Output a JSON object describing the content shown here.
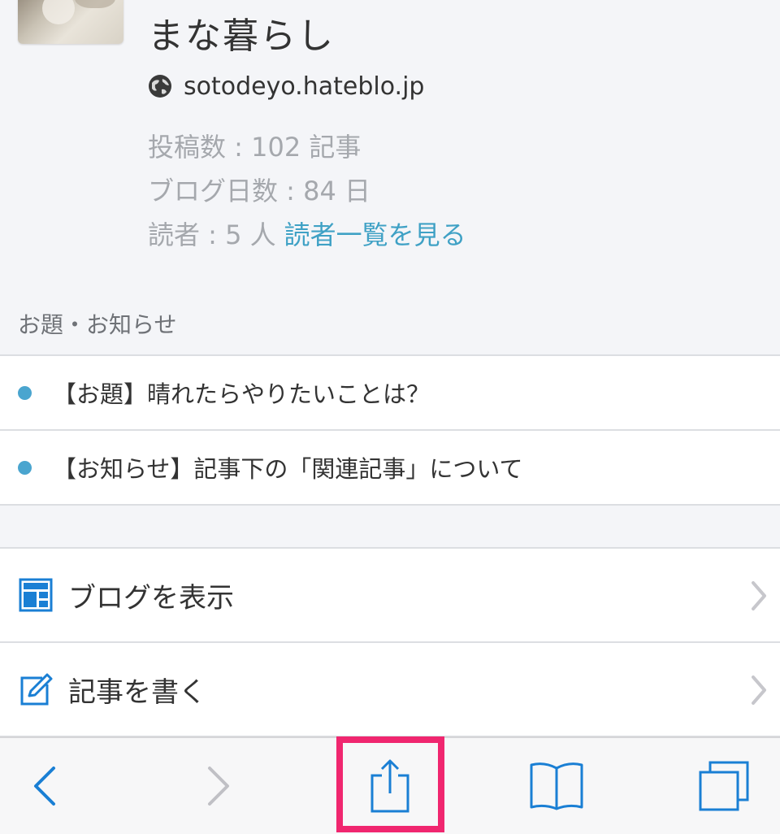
{
  "profile": {
    "blog_title": "まな暮らし",
    "url": "sotodeyo.hateblo.jp",
    "posts_label": "投稿数 : 102 記事",
    "days_label": "ブログ日数 : 84 日",
    "readers_label": "読者 : 5 人",
    "readers_link": "読者一覧を見る"
  },
  "notices": {
    "section_label": "お題・お知らせ",
    "items": [
      {
        "text": "【お題】晴れたらやりたいことは？"
      },
      {
        "text": "【お知らせ】記事下の「関連記事」について"
      }
    ]
  },
  "menu": {
    "items": [
      {
        "label": "ブログを表示",
        "icon": "layout-icon"
      },
      {
        "label": "記事を書く",
        "icon": "edit-icon"
      }
    ]
  },
  "toolbar": {
    "buttons": [
      "back",
      "forward",
      "share",
      "bookmarks",
      "tabs"
    ],
    "highlighted": "share",
    "highlight_color": "#f0266f"
  },
  "colors": {
    "accent": "#3fa1c5",
    "dot": "#4aa5cf",
    "ios_blue": "#1a7fd4"
  }
}
